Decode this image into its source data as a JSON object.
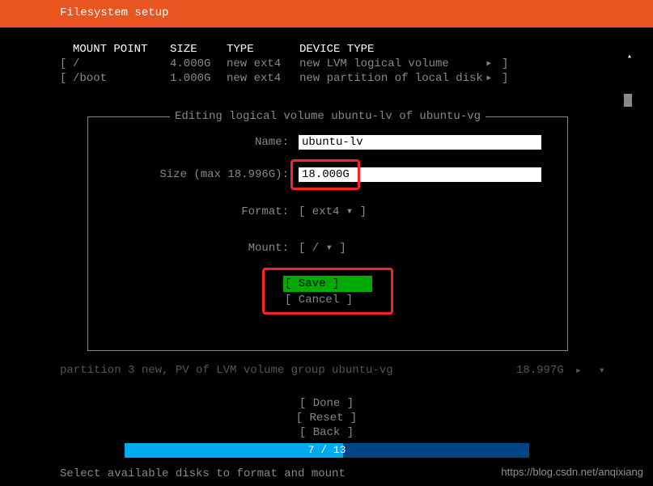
{
  "title": "Filesystem setup",
  "table": {
    "headers": {
      "mount": "MOUNT POINT",
      "size": "SIZE",
      "type": "TYPE",
      "devtype": "DEVICE TYPE"
    },
    "rows": [
      {
        "mount": "/",
        "size": "4.000G",
        "type": "new ext4",
        "devtype": "new LVM logical volume",
        "arrow": "▸"
      },
      {
        "mount": "/boot",
        "size": "1.000G",
        "type": "new ext4",
        "devtype": "new partition of local disk",
        "arrow": "▸"
      }
    ]
  },
  "scroll_up": "▴",
  "dialog": {
    "title": "Editing logical volume ubuntu-lv of ubuntu-vg",
    "name_label": "Name:",
    "name_value": "ubuntu-lv",
    "size_label": "Size (max 18.996G):",
    "size_value": "18.000G",
    "format_label": "Format:",
    "format_value": "[ ext4             ▾ ]",
    "mount_label": "Mount:",
    "mount_value": "[ /                ▾ ]",
    "save": "[ Save      ]",
    "cancel": "[ Cancel    ]"
  },
  "partition": {
    "text": "partition 3   new, PV of LVM volume group ubuntu-vg",
    "size": "18.997G",
    "arrows": "▸  ▾"
  },
  "footer": {
    "done": "[ Done      ]",
    "reset": "[ Reset     ]",
    "back": "[ Back      ]"
  },
  "progress": {
    "text": "7 / 13",
    "percent": 54
  },
  "hint": "Select available disks to format and mount",
  "watermark": "https://blog.csdn.net/anqixiang"
}
